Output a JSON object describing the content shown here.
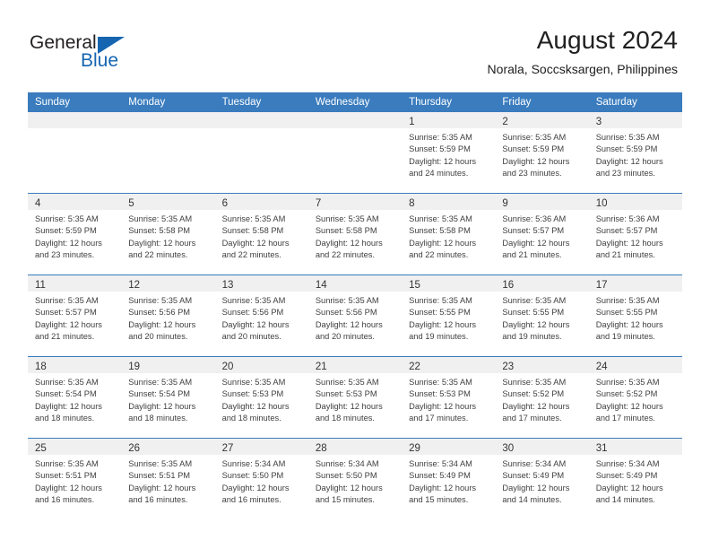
{
  "brand": {
    "name_top": "General",
    "name_bottom": "Blue",
    "accent_color": "#1565b0"
  },
  "header": {
    "title": "August 2024",
    "subtitle": "Norala, Soccsksargen, Philippines"
  },
  "theme": {
    "header_row_bg": "#3a7cbe",
    "daynum_band_bg": "#f0f0f0",
    "grid_line": "#3a7cbe"
  },
  "weekday_headers": [
    "Sunday",
    "Monday",
    "Tuesday",
    "Wednesday",
    "Thursday",
    "Friday",
    "Saturday"
  ],
  "labels": {
    "sunrise_prefix": "Sunrise:",
    "sunset_prefix": "Sunset:",
    "daylight_prefix": "Daylight:"
  },
  "weeks": [
    [
      {
        "day": "",
        "empty": true
      },
      {
        "day": "",
        "empty": true
      },
      {
        "day": "",
        "empty": true
      },
      {
        "day": "",
        "empty": true
      },
      {
        "day": "1",
        "sunrise": "Sunrise: 5:35 AM",
        "sunset": "Sunset: 5:59 PM",
        "daylight_1": "Daylight: 12 hours",
        "daylight_2": "and 24 minutes."
      },
      {
        "day": "2",
        "sunrise": "Sunrise: 5:35 AM",
        "sunset": "Sunset: 5:59 PM",
        "daylight_1": "Daylight: 12 hours",
        "daylight_2": "and 23 minutes."
      },
      {
        "day": "3",
        "sunrise": "Sunrise: 5:35 AM",
        "sunset": "Sunset: 5:59 PM",
        "daylight_1": "Daylight: 12 hours",
        "daylight_2": "and 23 minutes."
      }
    ],
    [
      {
        "day": "4",
        "sunrise": "Sunrise: 5:35 AM",
        "sunset": "Sunset: 5:59 PM",
        "daylight_1": "Daylight: 12 hours",
        "daylight_2": "and 23 minutes."
      },
      {
        "day": "5",
        "sunrise": "Sunrise: 5:35 AM",
        "sunset": "Sunset: 5:58 PM",
        "daylight_1": "Daylight: 12 hours",
        "daylight_2": "and 22 minutes."
      },
      {
        "day": "6",
        "sunrise": "Sunrise: 5:35 AM",
        "sunset": "Sunset: 5:58 PM",
        "daylight_1": "Daylight: 12 hours",
        "daylight_2": "and 22 minutes."
      },
      {
        "day": "7",
        "sunrise": "Sunrise: 5:35 AM",
        "sunset": "Sunset: 5:58 PM",
        "daylight_1": "Daylight: 12 hours",
        "daylight_2": "and 22 minutes."
      },
      {
        "day": "8",
        "sunrise": "Sunrise: 5:35 AM",
        "sunset": "Sunset: 5:58 PM",
        "daylight_1": "Daylight: 12 hours",
        "daylight_2": "and 22 minutes."
      },
      {
        "day": "9",
        "sunrise": "Sunrise: 5:36 AM",
        "sunset": "Sunset: 5:57 PM",
        "daylight_1": "Daylight: 12 hours",
        "daylight_2": "and 21 minutes."
      },
      {
        "day": "10",
        "sunrise": "Sunrise: 5:36 AM",
        "sunset": "Sunset: 5:57 PM",
        "daylight_1": "Daylight: 12 hours",
        "daylight_2": "and 21 minutes."
      }
    ],
    [
      {
        "day": "11",
        "sunrise": "Sunrise: 5:35 AM",
        "sunset": "Sunset: 5:57 PM",
        "daylight_1": "Daylight: 12 hours",
        "daylight_2": "and 21 minutes."
      },
      {
        "day": "12",
        "sunrise": "Sunrise: 5:35 AM",
        "sunset": "Sunset: 5:56 PM",
        "daylight_1": "Daylight: 12 hours",
        "daylight_2": "and 20 minutes."
      },
      {
        "day": "13",
        "sunrise": "Sunrise: 5:35 AM",
        "sunset": "Sunset: 5:56 PM",
        "daylight_1": "Daylight: 12 hours",
        "daylight_2": "and 20 minutes."
      },
      {
        "day": "14",
        "sunrise": "Sunrise: 5:35 AM",
        "sunset": "Sunset: 5:56 PM",
        "daylight_1": "Daylight: 12 hours",
        "daylight_2": "and 20 minutes."
      },
      {
        "day": "15",
        "sunrise": "Sunrise: 5:35 AM",
        "sunset": "Sunset: 5:55 PM",
        "daylight_1": "Daylight: 12 hours",
        "daylight_2": "and 19 minutes."
      },
      {
        "day": "16",
        "sunrise": "Sunrise: 5:35 AM",
        "sunset": "Sunset: 5:55 PM",
        "daylight_1": "Daylight: 12 hours",
        "daylight_2": "and 19 minutes."
      },
      {
        "day": "17",
        "sunrise": "Sunrise: 5:35 AM",
        "sunset": "Sunset: 5:55 PM",
        "daylight_1": "Daylight: 12 hours",
        "daylight_2": "and 19 minutes."
      }
    ],
    [
      {
        "day": "18",
        "sunrise": "Sunrise: 5:35 AM",
        "sunset": "Sunset: 5:54 PM",
        "daylight_1": "Daylight: 12 hours",
        "daylight_2": "and 18 minutes."
      },
      {
        "day": "19",
        "sunrise": "Sunrise: 5:35 AM",
        "sunset": "Sunset: 5:54 PM",
        "daylight_1": "Daylight: 12 hours",
        "daylight_2": "and 18 minutes."
      },
      {
        "day": "20",
        "sunrise": "Sunrise: 5:35 AM",
        "sunset": "Sunset: 5:53 PM",
        "daylight_1": "Daylight: 12 hours",
        "daylight_2": "and 18 minutes."
      },
      {
        "day": "21",
        "sunrise": "Sunrise: 5:35 AM",
        "sunset": "Sunset: 5:53 PM",
        "daylight_1": "Daylight: 12 hours",
        "daylight_2": "and 18 minutes."
      },
      {
        "day": "22",
        "sunrise": "Sunrise: 5:35 AM",
        "sunset": "Sunset: 5:53 PM",
        "daylight_1": "Daylight: 12 hours",
        "daylight_2": "and 17 minutes."
      },
      {
        "day": "23",
        "sunrise": "Sunrise: 5:35 AM",
        "sunset": "Sunset: 5:52 PM",
        "daylight_1": "Daylight: 12 hours",
        "daylight_2": "and 17 minutes."
      },
      {
        "day": "24",
        "sunrise": "Sunrise: 5:35 AM",
        "sunset": "Sunset: 5:52 PM",
        "daylight_1": "Daylight: 12 hours",
        "daylight_2": "and 17 minutes."
      }
    ],
    [
      {
        "day": "25",
        "sunrise": "Sunrise: 5:35 AM",
        "sunset": "Sunset: 5:51 PM",
        "daylight_1": "Daylight: 12 hours",
        "daylight_2": "and 16 minutes."
      },
      {
        "day": "26",
        "sunrise": "Sunrise: 5:35 AM",
        "sunset": "Sunset: 5:51 PM",
        "daylight_1": "Daylight: 12 hours",
        "daylight_2": "and 16 minutes."
      },
      {
        "day": "27",
        "sunrise": "Sunrise: 5:34 AM",
        "sunset": "Sunset: 5:50 PM",
        "daylight_1": "Daylight: 12 hours",
        "daylight_2": "and 16 minutes."
      },
      {
        "day": "28",
        "sunrise": "Sunrise: 5:34 AM",
        "sunset": "Sunset: 5:50 PM",
        "daylight_1": "Daylight: 12 hours",
        "daylight_2": "and 15 minutes."
      },
      {
        "day": "29",
        "sunrise": "Sunrise: 5:34 AM",
        "sunset": "Sunset: 5:49 PM",
        "daylight_1": "Daylight: 12 hours",
        "daylight_2": "and 15 minutes."
      },
      {
        "day": "30",
        "sunrise": "Sunrise: 5:34 AM",
        "sunset": "Sunset: 5:49 PM",
        "daylight_1": "Daylight: 12 hours",
        "daylight_2": "and 14 minutes."
      },
      {
        "day": "31",
        "sunrise": "Sunrise: 5:34 AM",
        "sunset": "Sunset: 5:49 PM",
        "daylight_1": "Daylight: 12 hours",
        "daylight_2": "and 14 minutes."
      }
    ]
  ]
}
